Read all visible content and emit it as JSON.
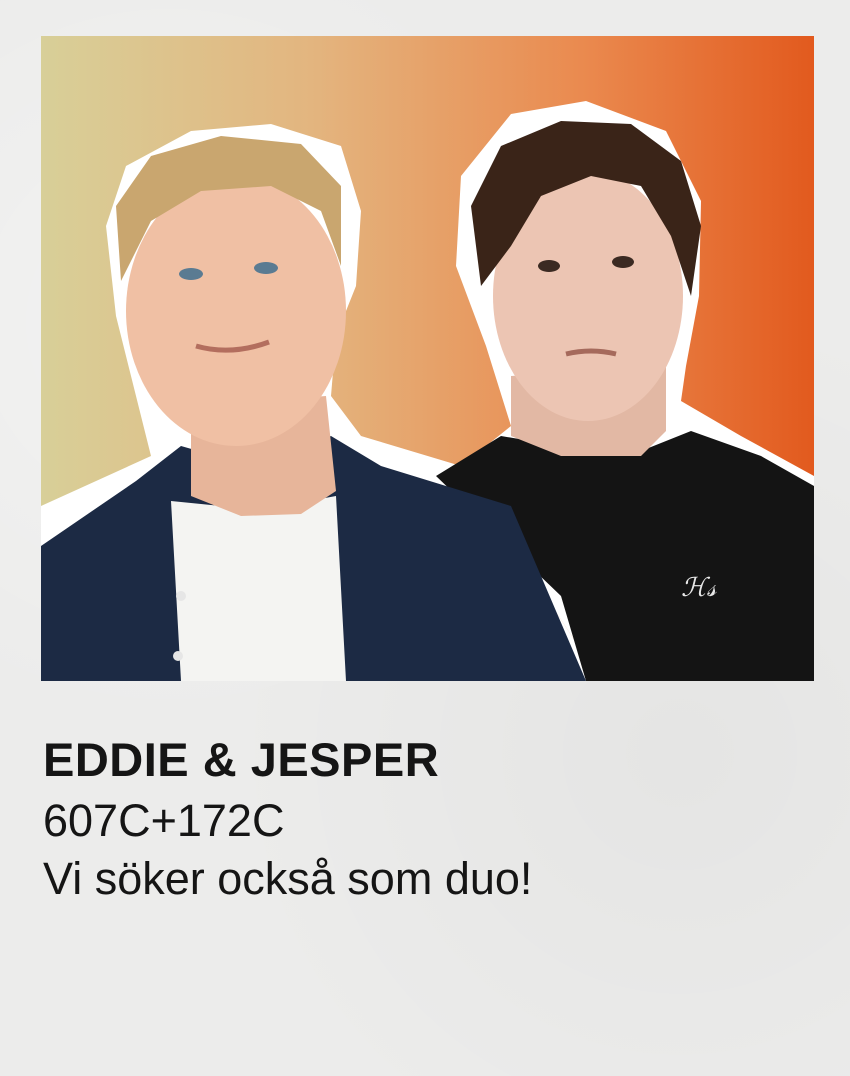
{
  "card": {
    "name": "EDDIE & JESPER",
    "code": "607C+172C",
    "tagline": "Vi söker också som duo!"
  },
  "colors": {
    "paper": "#ececeb",
    "gradient_left": "#d8cf98",
    "gradient_right": "#e25a1e",
    "text": "#151515"
  }
}
